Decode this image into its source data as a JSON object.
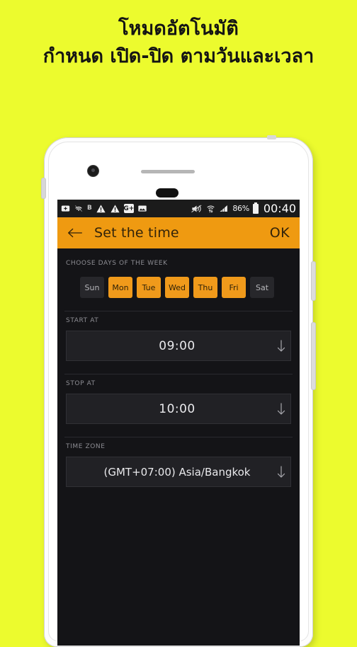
{
  "poster": {
    "background_color": "#ECFB2E",
    "headline_line1": "โหมดอัตโนมัติ",
    "headline_line2": "กำหนด เปิด-ปิด ตามวันและเวลา"
  },
  "phone": {
    "frame_color": "#FDFDFD"
  },
  "status_bar": {
    "icons": [
      "sd-card-icon",
      "wifi-disabled-icon",
      "bluetooth-icon",
      "warning-triangle-icon",
      "warning-triangle-icon",
      "google-plus-icon",
      "image-icon",
      "mute-icon",
      "wifi-transfer-icon",
      "signal-bars-icon"
    ],
    "bluetooth_glyph": "B",
    "google_plus_glyph": "G+",
    "battery_percent": "86%",
    "clock": "00:40",
    "background_color": "#1B1B1B"
  },
  "app_bar": {
    "back_label": "←",
    "title": "Set the time",
    "ok_label": "OK",
    "background_color": "#EF9A11",
    "text_color": "#32230A"
  },
  "content": {
    "days_section": {
      "label": "CHOOSE DAYS OF THE WEEK",
      "days": [
        {
          "label": "Sun",
          "selected": false
        },
        {
          "label": "Mon",
          "selected": true
        },
        {
          "label": "Tue",
          "selected": true
        },
        {
          "label": "Wed",
          "selected": true
        },
        {
          "label": "Thu",
          "selected": true
        },
        {
          "label": "Fri",
          "selected": true
        },
        {
          "label": "Sat",
          "selected": false
        }
      ],
      "selected_color": "#F09A1B",
      "unselected_color": "#27272B"
    },
    "start_at": {
      "label": "START AT",
      "value": "09:00"
    },
    "stop_at": {
      "label": "STOP AT",
      "value": "10:00"
    },
    "time_zone": {
      "label": "TIME ZONE",
      "value": "(GMT+07:00) Asia/Bangkok"
    },
    "background_color": "#141417"
  }
}
